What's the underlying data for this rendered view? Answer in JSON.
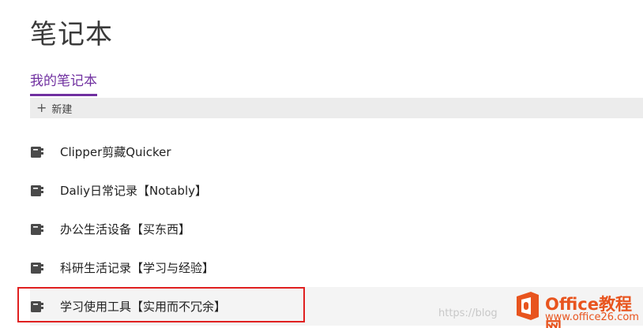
{
  "header": {
    "title": "笔记本"
  },
  "tabs": [
    {
      "label": "我的笔记本",
      "active": true
    }
  ],
  "toolbar": {
    "new_label": "新建"
  },
  "notebooks": [
    {
      "name": "Clipper剪藏Quicker",
      "icon": "notebook-icon"
    },
    {
      "name": "Daliy日常记录【Notably】",
      "icon": "notebook-icon"
    },
    {
      "name": "办公生活设备【买东西】",
      "icon": "notebook-icon"
    },
    {
      "name": "科研生活记录【学习与经验】",
      "icon": "notebook-icon"
    },
    {
      "name": "学习使用工具【实用而不冗余】",
      "icon": "notebook-icon",
      "highlighted": true
    }
  ],
  "watermark": {
    "url": "https://blog",
    "brand": "Office教程网",
    "domain": "www.office26.com"
  },
  "colors": {
    "accent": "#7030a0",
    "highlight_border": "#e02020",
    "watermark": "#e8541e"
  }
}
